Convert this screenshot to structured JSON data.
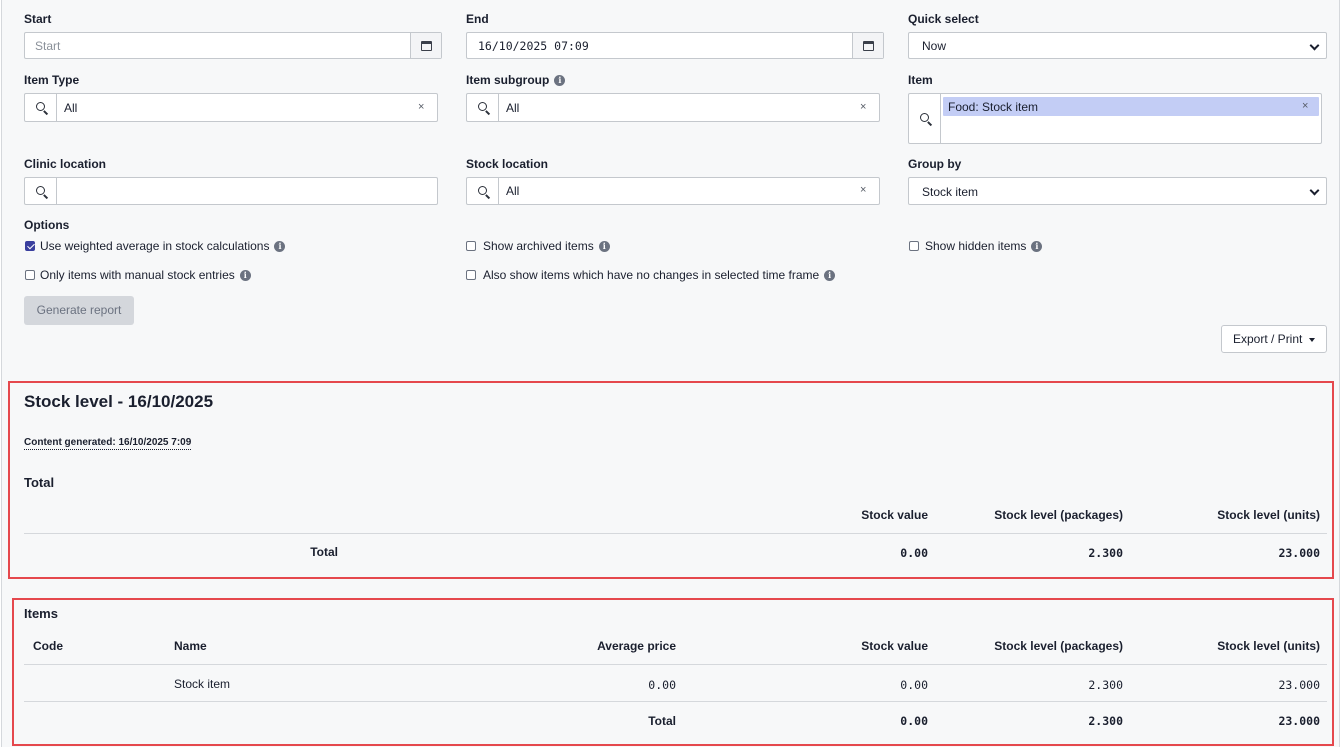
{
  "filters": {
    "start": {
      "label": "Start",
      "placeholder": "Start",
      "value": ""
    },
    "end": {
      "label": "End",
      "value": "16/10/2025 07:09"
    },
    "quick_select": {
      "label": "Quick select",
      "value": "Now"
    },
    "item_type": {
      "label": "Item Type",
      "value": "All"
    },
    "item_subgroup": {
      "label": "Item subgroup",
      "value": "All"
    },
    "item": {
      "label": "Item",
      "selected": "Food: Stock item"
    },
    "clinic_location": {
      "label": "Clinic location",
      "value": ""
    },
    "stock_location": {
      "label": "Stock location",
      "value": "All"
    },
    "group_by": {
      "label": "Group by",
      "value": "Stock item"
    }
  },
  "options": {
    "label": "Options",
    "items": [
      {
        "label": "Use weighted average in stock calculations",
        "checked": true
      },
      {
        "label": "Show archived items",
        "checked": false
      },
      {
        "label": "Show hidden items",
        "checked": false
      },
      {
        "label": "Only items with manual stock entries",
        "checked": false
      },
      {
        "label": "Also show items which have no changes in selected time frame",
        "checked": false
      }
    ]
  },
  "actions": {
    "generate": "Generate report",
    "export": "Export / Print"
  },
  "report": {
    "title": "Stock level - 16/10/2025",
    "generated": "Content generated: 16/10/2025 7:09",
    "total_section": {
      "heading": "Total",
      "columns": [
        "Stock value",
        "Stock level (packages)",
        "Stock level (units)"
      ],
      "row": {
        "label": "Total",
        "stock_value": "0.00",
        "packages": "2.300",
        "units": "23.000"
      }
    },
    "items_section": {
      "heading": "Items",
      "columns": [
        "Code",
        "Name",
        "Average price",
        "Stock value",
        "Stock level (packages)",
        "Stock level (units)"
      ],
      "rows": [
        {
          "code": "",
          "name": "Stock item",
          "avg_price": "0.00",
          "stock_value": "0.00",
          "packages": "2.300",
          "units": "23.000"
        }
      ],
      "total": {
        "label": "Total",
        "stock_value": "0.00",
        "packages": "2.300",
        "units": "23.000"
      }
    }
  }
}
